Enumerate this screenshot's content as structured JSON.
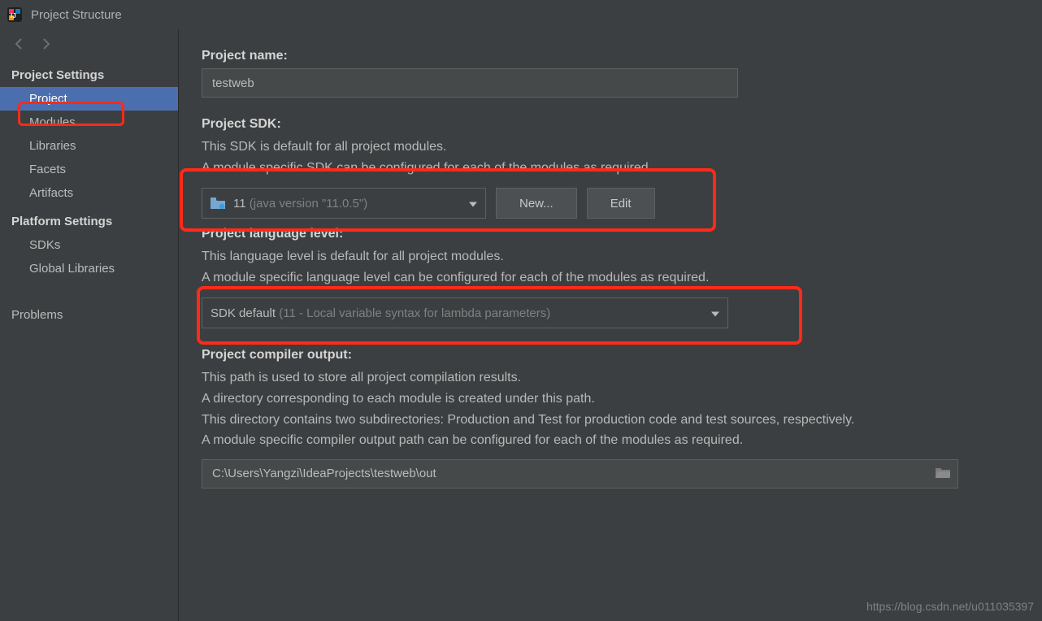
{
  "window": {
    "title": "Project Structure"
  },
  "sidebar": {
    "section1": "Project Settings",
    "section2": "Platform Settings",
    "items1": [
      {
        "label": "Project"
      },
      {
        "label": "Modules"
      },
      {
        "label": "Libraries"
      },
      {
        "label": "Facets"
      },
      {
        "label": "Artifacts"
      }
    ],
    "items2": [
      {
        "label": "SDKs"
      },
      {
        "label": "Global Libraries"
      }
    ],
    "problems": "Problems"
  },
  "project": {
    "name_label": "Project name:",
    "name_value": "testweb",
    "sdk_label": "Project SDK:",
    "sdk_desc1": "This SDK is default for all project modules.",
    "sdk_desc2": "A module specific SDK can be configured for each of the modules as required.",
    "sdk_selected_main": "11",
    "sdk_selected_dim": "(java version \"11.0.5\")",
    "new_button": "New...",
    "edit_button": "Edit",
    "lang_label": "Project language level:",
    "lang_desc1": "This language level is default for all project modules.",
    "lang_desc2": "A module specific language level can be configured for each of the modules as required.",
    "lang_selected_main": "SDK default",
    "lang_selected_dim": "(11 - Local variable syntax for lambda parameters)",
    "out_label": "Project compiler output:",
    "out_desc1": "This path is used to store all project compilation results.",
    "out_desc2": "A directory corresponding to each module is created under this path.",
    "out_desc3": "This directory contains two subdirectories: Production and Test for production code and test sources, respectively.",
    "out_desc4": "A module specific compiler output path can be configured for each of the modules as required.",
    "out_value": "C:\\Users\\Yangzi\\IdeaProjects\\testweb\\out"
  },
  "watermark": "https://blog.csdn.net/u011035397"
}
